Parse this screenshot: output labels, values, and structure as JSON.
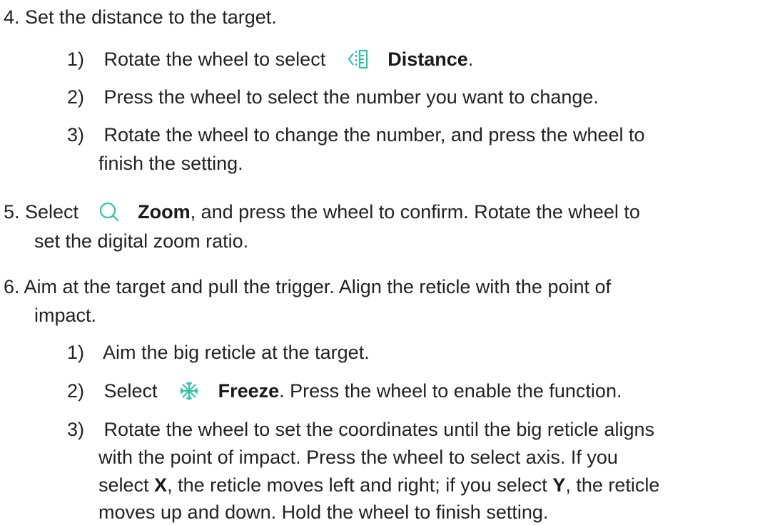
{
  "accent_color": "#2ec4a6",
  "step4": {
    "heading": "4. Set the distance to the target.",
    "sub1": {
      "num": "1)",
      "before": "Rotate the wheel to select",
      "icon": "distance-icon",
      "term": "Distance",
      "after": "."
    },
    "sub2": {
      "num": "2)",
      "text": "Press the wheel to select the number you want to change."
    },
    "sub3": {
      "num": "3)",
      "line1": "Rotate the wheel to change the number, and press the wheel to",
      "line2": "finish the setting."
    }
  },
  "step5": {
    "before": "5. Select",
    "icon": "zoom-icon",
    "term": "Zoom",
    "after": ", and press the wheel to confirm. Rotate the wheel to",
    "line2": "set the digital zoom ratio."
  },
  "step6": {
    "line1": "6. Aim at the target and pull the trigger. Align the reticle with the point of",
    "line2": "impact.",
    "sub1": {
      "num": "1)",
      "text": "Aim the big reticle at the target."
    },
    "sub2": {
      "num": "2)",
      "before": "Select",
      "icon": "freeze-icon",
      "term": "Freeze",
      "after": ". Press the wheel to enable the function."
    },
    "sub3": {
      "num": "3)",
      "line1": "Rotate the wheel to set the coordinates until the big reticle aligns",
      "line2": "with the point of impact. Press the wheel to select axis. If you",
      "line3_a": "select ",
      "line3_x": "X",
      "line3_b": ", the reticle moves left and right; if you select ",
      "line3_y": "Y",
      "line3_c": ", the reticle",
      "line4": "moves up and down. Hold the wheel to finish setting."
    }
  }
}
